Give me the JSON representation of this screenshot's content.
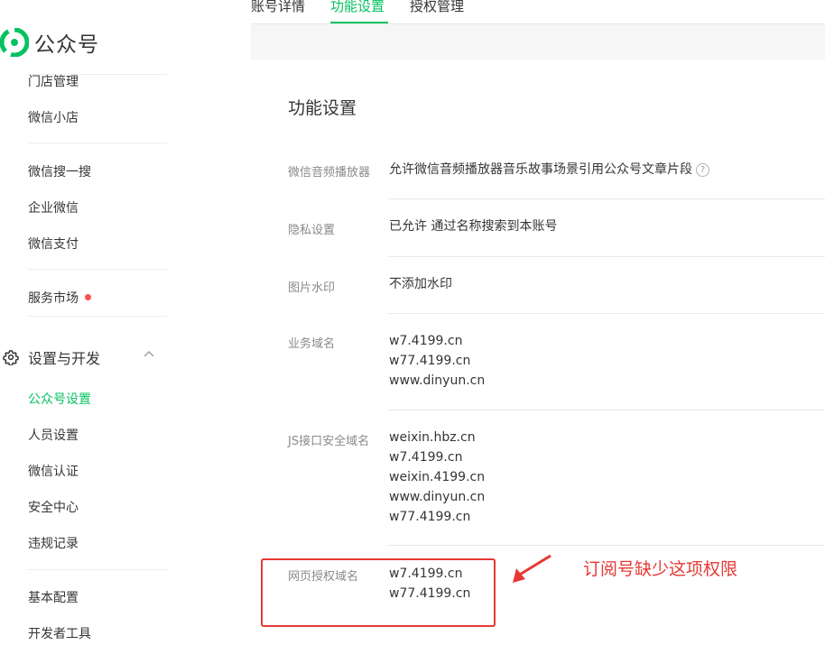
{
  "brand": {
    "name": "公众号",
    "colors": {
      "accent": "#07c160",
      "annotation": "#e53935",
      "badge": "#fa5151"
    }
  },
  "sidebar": {
    "items_top": [
      {
        "label": "门店管理"
      },
      {
        "label": "微信小店"
      },
      {
        "label": "微信搜一搜"
      },
      {
        "label": "企业微信"
      },
      {
        "label": "微信支付"
      },
      {
        "label": "服务市场"
      }
    ],
    "section": {
      "title": "设置与开发",
      "icon": "gear-icon",
      "expanded": true
    },
    "section_items": [
      {
        "label": "公众号设置",
        "active": true
      },
      {
        "label": "人员设置"
      },
      {
        "label": "微信认证"
      },
      {
        "label": "安全中心"
      },
      {
        "label": "违规记录"
      }
    ],
    "items_bottom": [
      {
        "label": "基本配置"
      },
      {
        "label": "开发者工具"
      }
    ]
  },
  "tabs": [
    {
      "label": "账号详情"
    },
    {
      "label": "功能设置",
      "active": true
    },
    {
      "label": "授权管理"
    }
  ],
  "content": {
    "title": "功能设置",
    "rows": [
      {
        "label": "微信音频播放器",
        "value": "允许微信音频播放器音乐故事场景引用公众号文章片段",
        "help_icon": "help-icon"
      },
      {
        "label": "隐私设置",
        "value": "已允许 通过名称搜索到本账号"
      },
      {
        "label": "图片水印",
        "value": "不添加水印"
      },
      {
        "label": "业务域名",
        "values": [
          "w7.4199.cn",
          "w77.4199.cn",
          "www.dinyun.cn"
        ]
      },
      {
        "label": "JS接口安全域名",
        "values": [
          "weixin.hbz.cn",
          "w7.4199.cn",
          "weixin.4199.cn",
          "www.dinyun.cn",
          "w77.4199.cn"
        ]
      },
      {
        "label": "网页授权域名",
        "values": [
          "w7.4199.cn",
          "w77.4199.cn"
        ]
      }
    ]
  },
  "annotation": {
    "text": "订阅号缺少这项权限"
  }
}
